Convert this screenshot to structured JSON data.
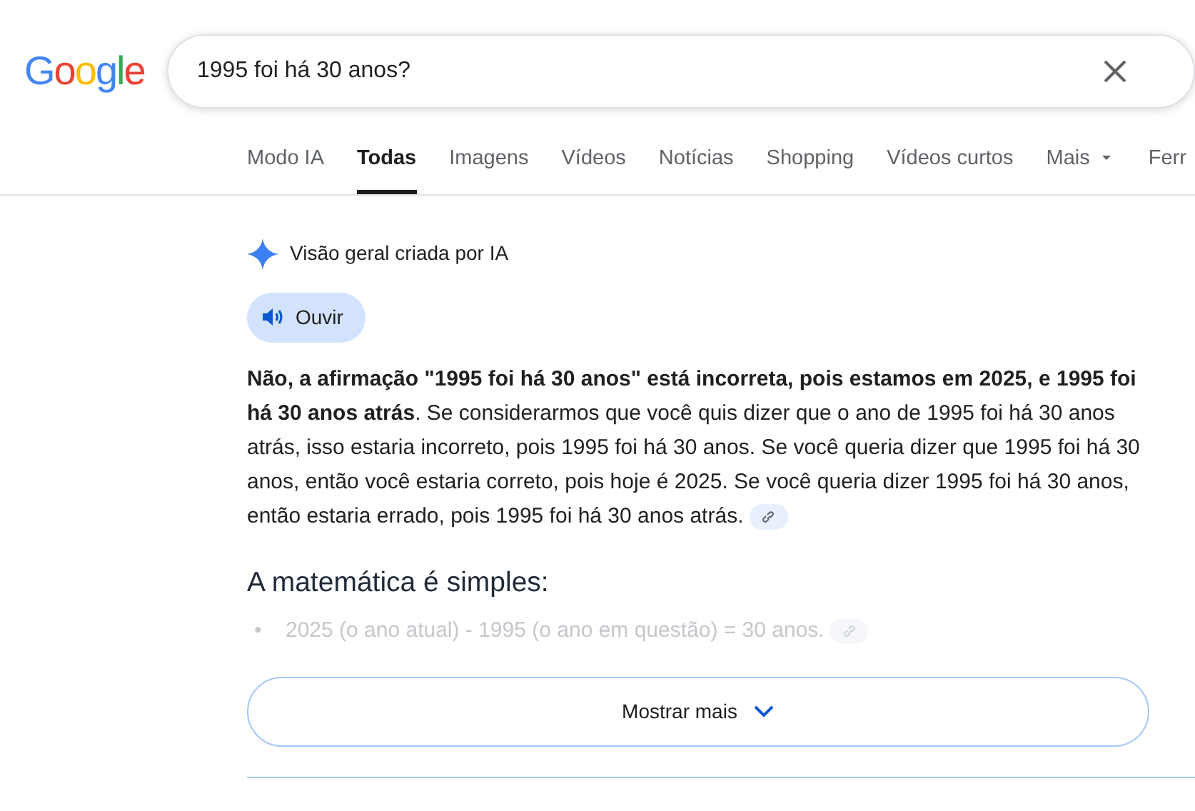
{
  "logo": "Google",
  "search": {
    "value": "1995 foi há 30 anos?"
  },
  "tabs": [
    {
      "label": "Modo IA",
      "selected": false
    },
    {
      "label": "Todas",
      "selected": true
    },
    {
      "label": "Imagens",
      "selected": false
    },
    {
      "label": "Vídeos",
      "selected": false
    },
    {
      "label": "Notícias",
      "selected": false
    },
    {
      "label": "Shopping",
      "selected": false
    },
    {
      "label": "Vídeos curtos",
      "selected": false
    },
    {
      "label": "Mais",
      "selected": false,
      "dropdown": true
    },
    {
      "label": "Ferr",
      "selected": false
    }
  ],
  "overview": {
    "title": "Visão geral criada por IA",
    "listen_button": "Ouvir",
    "paragraph": "**Não, a afirmação \"1995 foi há 30 anos\" está incorreta, pois estamos em 2025, e 1995 foi há 30 anos atrás**. Se considerarmos que você quis dizer que o ano de 1995 foi há 30 anos atrás, isso estaria incorreto, pois 1995 foi há 30 anos. Se você queria dizer que 1995 foi há 30 anos, então você estaria correto, pois hoje é 2025. Se você queria dizer 1995 foi há 30 anos, então estaria errado, pois 1995 foi há 30 anos atrás.",
    "heading": "A matemática é simples:",
    "bullets": [
      {
        "marker": "•",
        "text": "2025 (o ano atual) - 1995 (o ano em questão) = 30 anos.",
        "faded": true
      }
    ],
    "show_more": "Mostrar mais"
  }
}
